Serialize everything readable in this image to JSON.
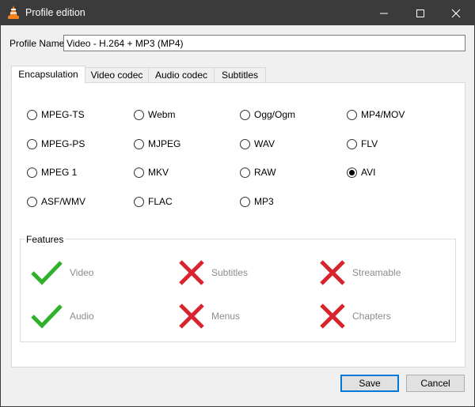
{
  "window": {
    "title": "Profile edition",
    "controls": {
      "minimize_icon": "minimize-icon",
      "maximize_icon": "maximize-icon",
      "close_icon": "close-icon"
    }
  },
  "profile": {
    "label": "Profile Name",
    "value": "Video - H.264 + MP3 (MP4)"
  },
  "tabs": [
    {
      "label": "Encapsulation",
      "active": true
    },
    {
      "label": "Video codec",
      "active": false
    },
    {
      "label": "Audio codec",
      "active": false
    },
    {
      "label": "Subtitles",
      "active": false
    }
  ],
  "formats": [
    {
      "label": "MPEG-TS",
      "selected": false
    },
    {
      "label": "Webm",
      "selected": false
    },
    {
      "label": "Ogg/Ogm",
      "selected": false
    },
    {
      "label": "MP4/MOV",
      "selected": false
    },
    {
      "label": "MPEG-PS",
      "selected": false
    },
    {
      "label": "MJPEG",
      "selected": false
    },
    {
      "label": "WAV",
      "selected": false
    },
    {
      "label": "FLV",
      "selected": false
    },
    {
      "label": "MPEG 1",
      "selected": false
    },
    {
      "label": "MKV",
      "selected": false
    },
    {
      "label": "RAW",
      "selected": false
    },
    {
      "label": "AVI",
      "selected": true
    },
    {
      "label": "ASF/WMV",
      "selected": false
    },
    {
      "label": "FLAC",
      "selected": false
    },
    {
      "label": "MP3",
      "selected": false
    }
  ],
  "features": {
    "title": "Features",
    "items": [
      {
        "label": "Video",
        "supported": true
      },
      {
        "label": "Subtitles",
        "supported": false
      },
      {
        "label": "Streamable",
        "supported": false
      },
      {
        "label": "Audio",
        "supported": true
      },
      {
        "label": "Menus",
        "supported": false
      },
      {
        "label": "Chapters",
        "supported": false
      }
    ]
  },
  "buttons": {
    "save": "Save",
    "cancel": "Cancel"
  },
  "colors": {
    "titlebar": "#3b3b3b",
    "check": "#2fb12a",
    "cross": "#d9232d",
    "default_button_border": "#0078d7"
  }
}
